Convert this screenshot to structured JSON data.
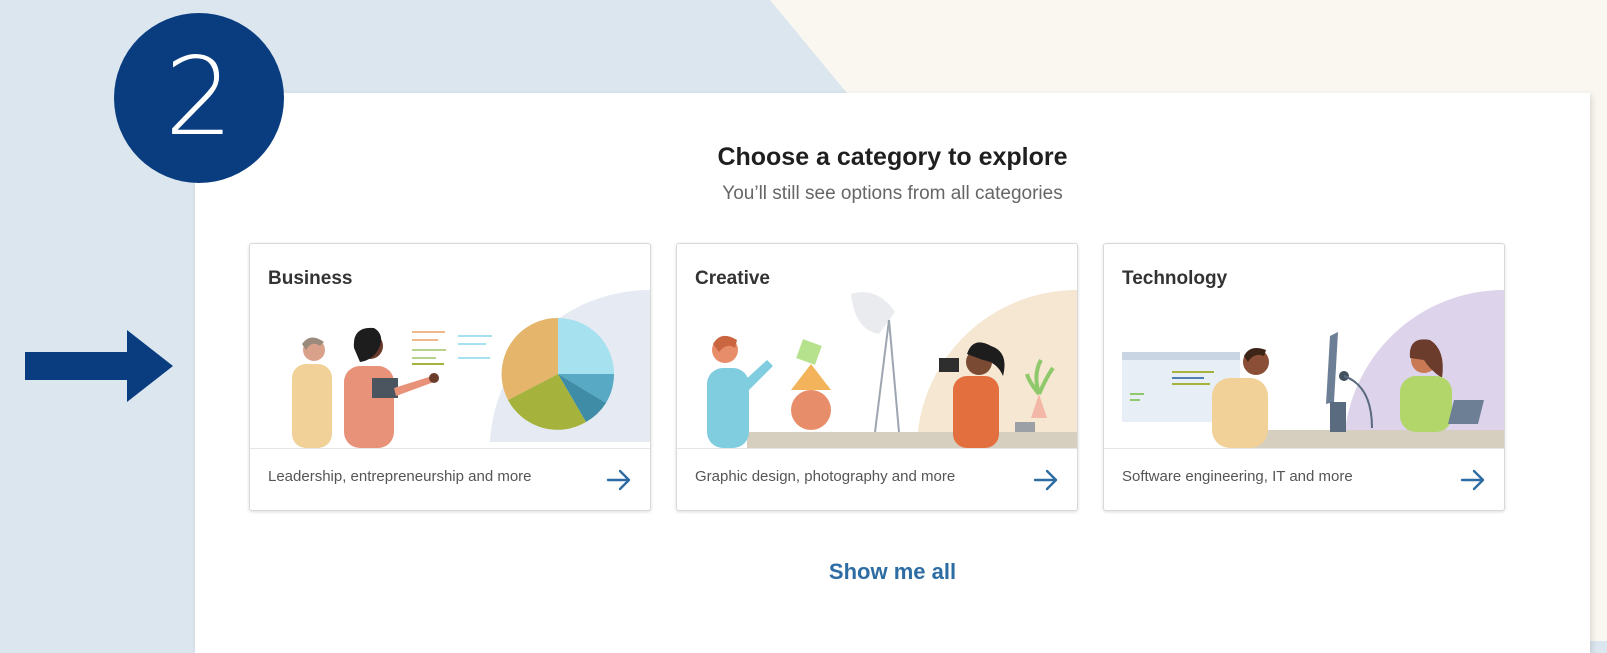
{
  "step": {
    "number": "2"
  },
  "colors": {
    "step_navy": "#0a3d80",
    "page_blue": "#dce6ef",
    "page_cream": "#faf7f1",
    "link_blue": "#2d6da3"
  },
  "panel": {
    "title": "Choose a category to explore",
    "subtitle": "You’ll still see options from all categories",
    "show_all_label": "Show me all"
  },
  "cards": [
    {
      "title": "Business",
      "description": "Leadership, entrepreneurship and more",
      "icon": "arrow-right-icon"
    },
    {
      "title": "Creative",
      "description": "Graphic design, photography and more",
      "icon": "arrow-right-icon"
    },
    {
      "title": "Technology",
      "description": "Software engineering, IT and more",
      "icon": "arrow-right-icon"
    }
  ]
}
